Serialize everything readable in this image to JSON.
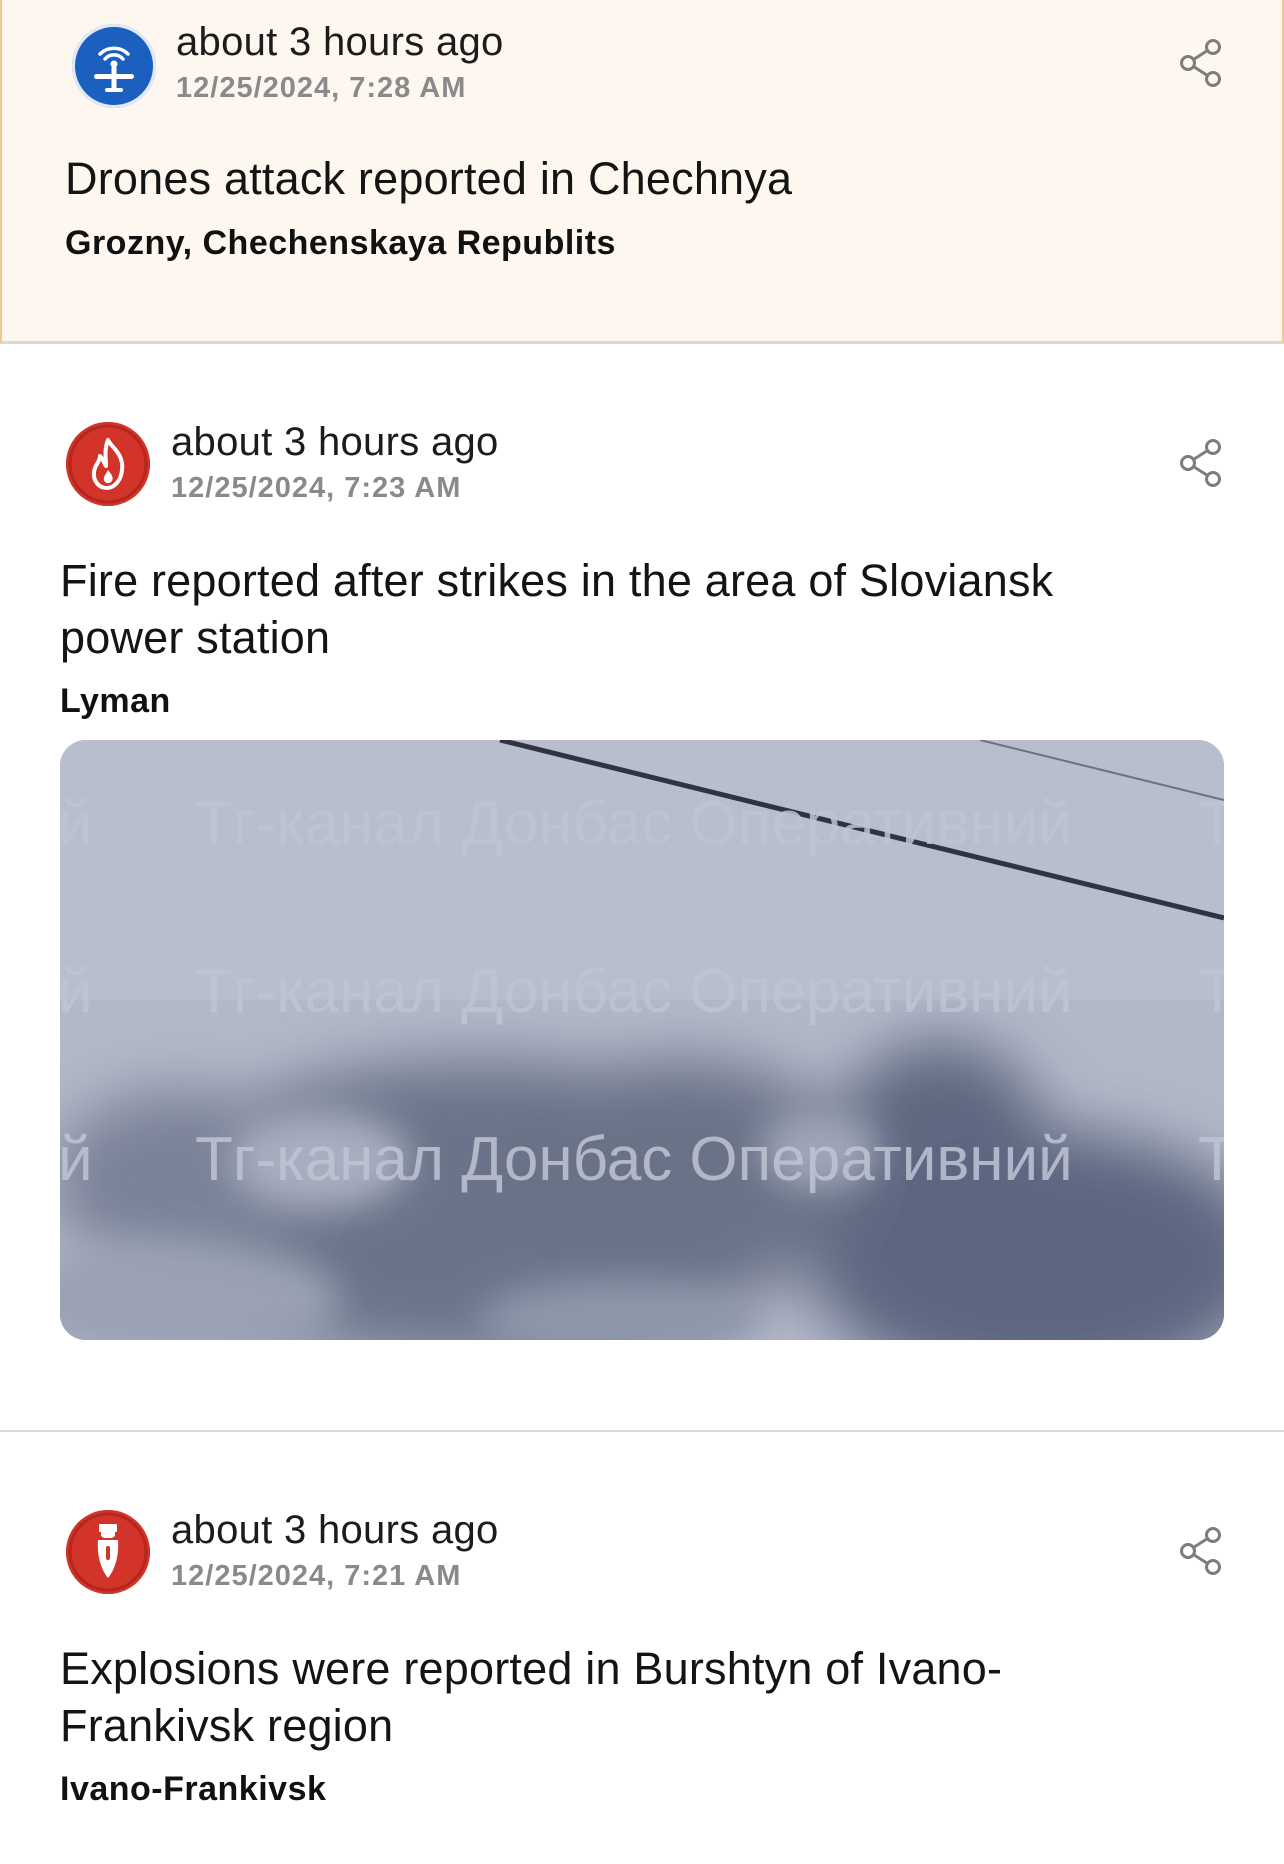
{
  "events": [
    {
      "icon": "drone-icon",
      "icon_color": "#1b5fbf",
      "time_relative": "about 3 hours ago",
      "time_absolute": "12/25/2024, 7:28 AM",
      "title": "Drones attack reported in Chechnya",
      "location": "Grozny, Chechenskaya Republits",
      "highlighted": true
    },
    {
      "icon": "fire-icon",
      "icon_color": "#d3342a",
      "time_relative": "about 3 hours ago",
      "time_absolute": "12/25/2024, 7:23 AM",
      "title": "Fire reported after strikes in the area of Sloviansk power station",
      "location": "Lyman",
      "image": {
        "description_icon": "smoke-photo",
        "watermark_text": "Тг-канал Донбас Оперативний",
        "watermark_edge_left": "й",
        "watermark_edge_right": "Т"
      }
    },
    {
      "icon": "bomb-icon",
      "icon_color": "#d3342a",
      "time_relative": "about 3 hours ago",
      "time_absolute": "12/25/2024, 7:21 AM",
      "title": "Explosions were reported in Burshtyn of Ivano-Frankivsk region",
      "location": "Ivano-Frankivsk"
    }
  ],
  "share_icon": "share-icon",
  "colors": {
    "highlight_background": "#fdf7ef",
    "highlight_border": "#f0c98f",
    "divider": "#d8d8d8",
    "secondary_text": "#8a8a8a"
  }
}
